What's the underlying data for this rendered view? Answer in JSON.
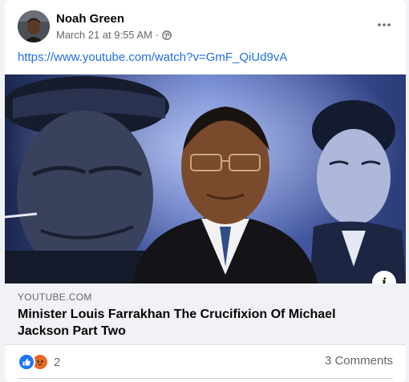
{
  "post": {
    "author": "Noah Green",
    "timestamp": "March 21 at 9:55 AM",
    "separator": "·",
    "privacy_icon": "globe-icon",
    "more_icon": "more-horizontal-icon",
    "link_text": "https://www.youtube.com/watch?v=GmF_QiUd9vA"
  },
  "link_preview": {
    "domain": "YOUTUBE.COM",
    "title": "Minister Louis Farrakhan The Crucifixion Of Michael Jackson Part Two",
    "info_icon_label": "i"
  },
  "engagement": {
    "reaction_icons": [
      "like-icon",
      "angry-icon"
    ],
    "reaction_count": "2",
    "comments": "3 Comments"
  },
  "colors": {
    "link": "#216fdb",
    "like": "#1877f2",
    "angry": "#e56a28",
    "secondary_text": "#65676b"
  }
}
